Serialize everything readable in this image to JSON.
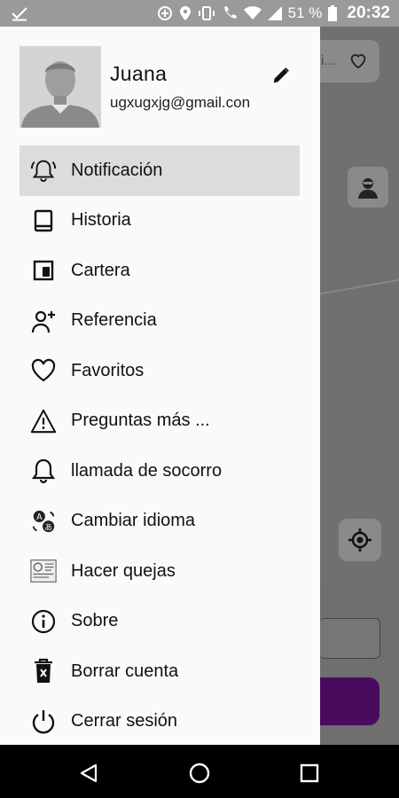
{
  "status_bar": {
    "battery": "51 %",
    "time": "20:32",
    "icons": [
      "download-done-icon",
      "data-saver-icon",
      "location-icon",
      "vibrate-icon",
      "wifi-call-icon",
      "wifi-icon",
      "signal-icon",
      "battery-icon"
    ]
  },
  "background": {
    "search_pill_text": "i...",
    "pill_icon": "heart-icon",
    "avatar_icon": "driver-avatar-icon",
    "gps_icon": "gps-target-icon",
    "primary_button_color": "#4a0b5e"
  },
  "profile": {
    "name": "Juana",
    "email": "ugxugxjg@gmail.con",
    "edit_icon": "pencil-icon"
  },
  "menu": {
    "items": [
      {
        "label": "Notificación",
        "icon": "bell-ringing-icon",
        "active": true
      },
      {
        "label": "Historia",
        "icon": "book-icon"
      },
      {
        "label": "Cartera",
        "icon": "wallet-icon"
      },
      {
        "label": "Referencia",
        "icon": "person-add-icon"
      },
      {
        "label": "Favoritos",
        "icon": "heart-icon"
      },
      {
        "label": "Preguntas más ...",
        "icon": "warning-icon"
      },
      {
        "label": "llamada de socorro",
        "icon": "bell-icon"
      },
      {
        "label": "Cambiar idioma",
        "icon": "translate-icon"
      },
      {
        "label": "Hacer quejas",
        "icon": "complaint-icon"
      },
      {
        "label": "Sobre",
        "icon": "info-icon"
      },
      {
        "label": "Borrar cuenta",
        "icon": "trash-icon"
      },
      {
        "label": "Cerrar sesión",
        "icon": "power-icon"
      }
    ]
  },
  "nav_bar": {
    "back": "back-triangle-icon",
    "home": "home-circle-icon",
    "recents": "recents-square-icon"
  }
}
